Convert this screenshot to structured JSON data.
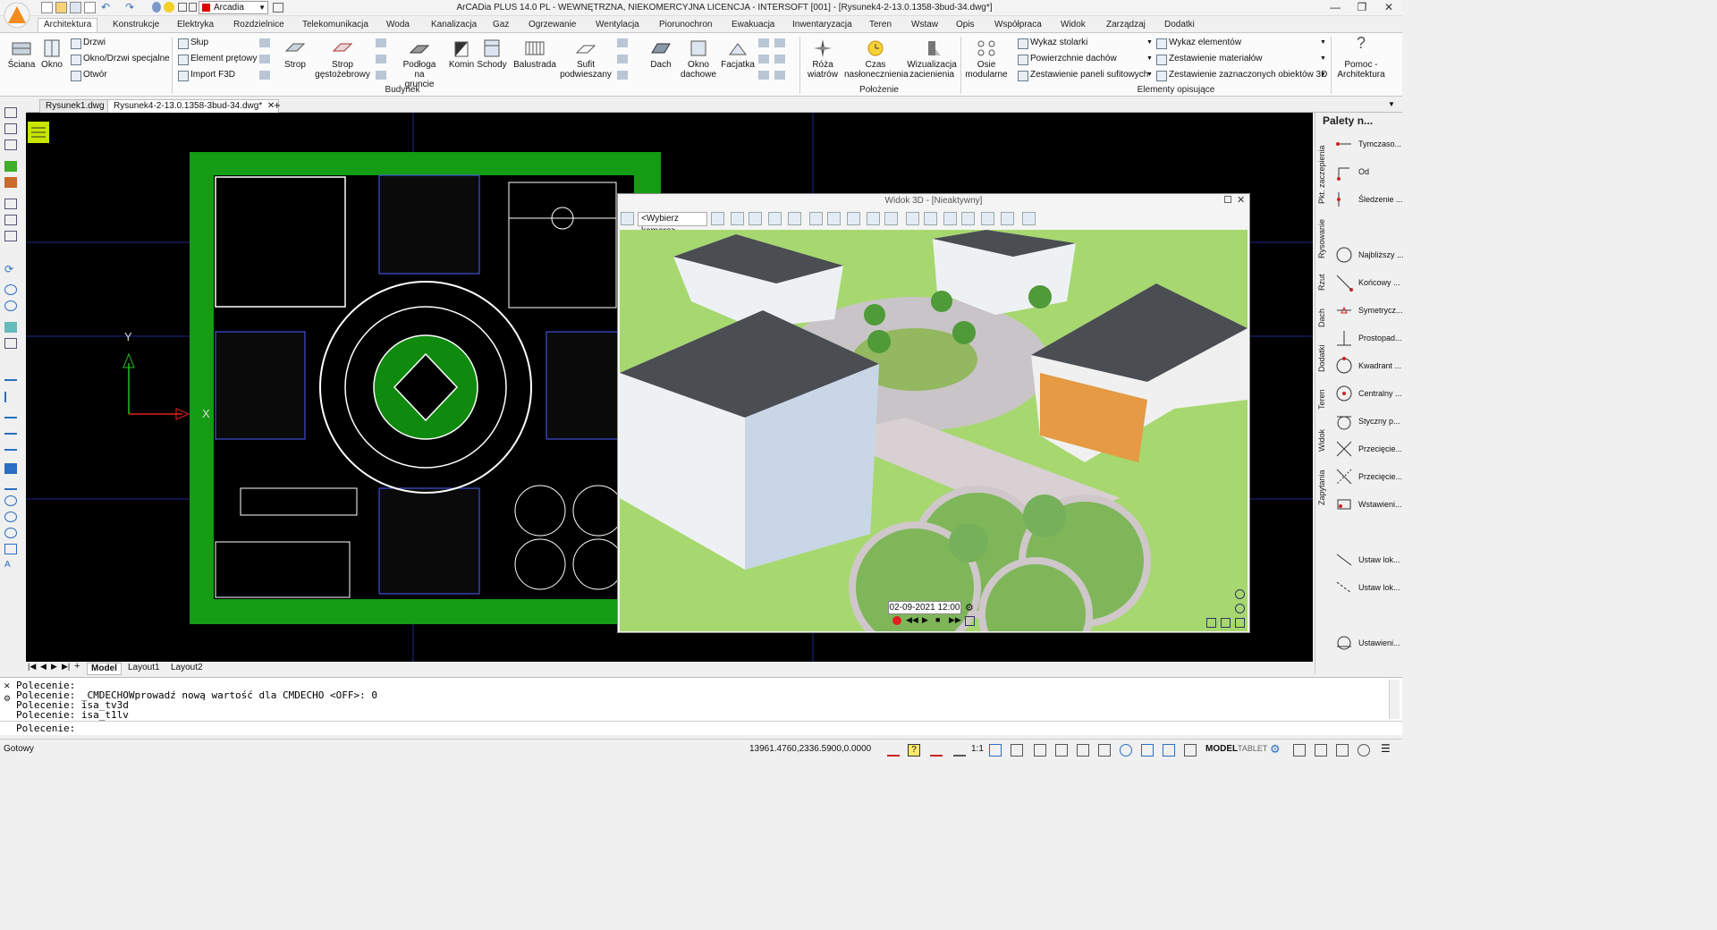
{
  "app": {
    "window_title": "ArCADia PLUS 14.0 PL - WEWNĘTRZNA, NIEKOMERCYJNA LICENCJA - INTERSOFT [001] - [Rysunek4-2-13.0.1358-3bud-34.dwg*]",
    "profile_name": "Arcadia"
  },
  "menu_tabs": [
    "Architektura",
    "Konstrukcje",
    "Elektryka",
    "Rozdzielnice",
    "Telekomunikacja",
    "Woda",
    "Kanalizacja",
    "Gaz",
    "Ogrzewanie",
    "Wentylacja",
    "Piorunochron",
    "Ewakuacja",
    "Inwentaryzacja",
    "Teren",
    "Wstaw",
    "Opis",
    "Współpraca",
    "Widok",
    "Zarządzaj",
    "Dodatki"
  ],
  "ribbon": {
    "big_buttons": {
      "sciana": "Ściana",
      "okno": "Okno",
      "strop": "Strop",
      "strop_gest": "Strop gęstożebrowy",
      "podloga": "Podłoga na gruncie",
      "komin": "Komin",
      "schody": "Schody",
      "balustrada": "Balustrada",
      "sufit": "Sufit podwieszany",
      "dach": "Dach",
      "okno_dachowe": "Okno dachowe",
      "facjatka": "Facjatka",
      "roza": "Róża wiatrów",
      "czas": "Czas nasłonecznienia",
      "wizualizacja": "Wizualizacja zacienienia",
      "osie": "Osie modularne",
      "pomoc": "Pomoc - Architektura"
    },
    "small_buttons": {
      "drzwi": "Drzwi",
      "okno_drzwi": "Okno/Drzwi specjalne",
      "otwor": "Otwór",
      "slup": "Słup",
      "element": "Element prętowy",
      "import": "Import F3D",
      "wykaz_stolarki": "Wykaz stolarki",
      "powierzchnie": "Powierzchnie dachów",
      "zestawienie_paneli": "Zestawienie paneli sufitowych",
      "wykaz_elementow": "Wykaz elementów",
      "zestawienie_mat": "Zestawienie materiałów",
      "zestawienie_zazn": "Zestawienie zaznaczonych obiektów 3D"
    },
    "groups": {
      "budynek": "Budynek",
      "polozenie": "Położenie",
      "elementy": "Elementy opisujące"
    }
  },
  "doc_tabs": [
    "Rysunek1.dwg",
    "Rysunek4-2-13.0.1358-3bud-34.dwg*"
  ],
  "canvas": {
    "axis_x": "X",
    "axis_y": "Y"
  },
  "view3d": {
    "title": "Widok 3D - [Nieaktywny]",
    "camera_select": "<Wybierz kamerę>",
    "datetime": "02-09-2021 12:00"
  },
  "palette": {
    "title": "Palety n...",
    "vertical_tabs": [
      "Pkt. zaczepienia",
      "Rysowanie",
      "Rzut",
      "Dach",
      "Dodatki",
      "Teren",
      "Widok",
      "Zapytania"
    ],
    "items": [
      "Tymczaso...",
      "Od",
      "Śledzenie ...",
      "Najbliższy ...",
      "Końcowy ...",
      "Symetrycz...",
      "Prostopad...",
      "Kwadrant ...",
      "Centralny ...",
      "Styczny p...",
      "Przecięcie...",
      "Przecięcie...",
      "Wstawieni...",
      "Ustaw lok...",
      "Ustaw lok...",
      "Ustawieni..."
    ]
  },
  "layout_tabs": [
    "Model",
    "Layout1",
    "Layout2"
  ],
  "command": {
    "history": [
      "Polecenie:",
      "Polecenie: _CMDECHOWprowadź nową wartość dla CMDECHO <OFF>: 0",
      "Polecenie: isa_tv3d",
      "Polecenie: isa_t1lv"
    ],
    "prompt": "Polecenie:"
  },
  "status": {
    "state": "Gotowy",
    "coords": "13961.4760,2336.5900,0.0000",
    "scale": "1:1",
    "model": "MODEL",
    "tablet": "TABLET"
  },
  "colors": {
    "canvas_bg": "#000000",
    "plan_green": "#1fa21f",
    "accent_orange": "#f28c1e"
  }
}
